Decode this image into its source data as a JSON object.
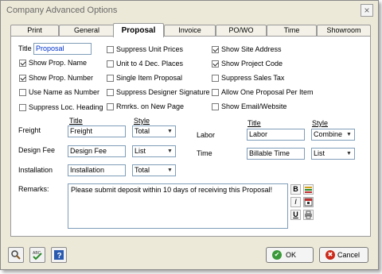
{
  "window": {
    "title": "Company Advanced Options",
    "close": "×"
  },
  "tabs": [
    "Print",
    "General",
    "Proposal",
    "Invoice",
    "PO/WO",
    "Time",
    "Showroom"
  ],
  "proposal": {
    "title_label": "Title",
    "title_value": "Proposal",
    "checkboxes": {
      "show_prop_name": {
        "label": "Show Prop. Name",
        "checked": true
      },
      "show_prop_number": {
        "label": "Show Prop. Number",
        "checked": true
      },
      "use_name_as_number": {
        "label": "Use Name as Number",
        "checked": false
      },
      "suppress_loc_heading": {
        "label": "Suppress Loc. Heading",
        "checked": false
      },
      "suppress_unit_prices": {
        "label": "Suppress Unit Prices",
        "checked": false
      },
      "unit_to_4_dec": {
        "label": "Unit to 4 Dec. Places",
        "checked": false
      },
      "single_item_proposal": {
        "label": "Single Item Proposal",
        "checked": false
      },
      "suppress_designer_signature": {
        "label": "Suppress Designer Signature",
        "checked": false
      },
      "rmrks_new_page": {
        "label": "Rmrks. on New Page",
        "checked": false
      },
      "show_site_address": {
        "label": "Show Site Address",
        "checked": true
      },
      "show_project_code": {
        "label": "Show Project Code",
        "checked": true
      },
      "suppress_sales_tax": {
        "label": "Suppress Sales Tax",
        "checked": false
      },
      "allow_one_proposal": {
        "label": "Allow One Proposal Per Item",
        "checked": false
      },
      "show_email_website": {
        "label": "Show Email/Website",
        "checked": false
      }
    },
    "col_title": "Title",
    "col_style": "Style",
    "rows": {
      "freight": {
        "label": "Freight",
        "title": "Freight",
        "style": "Total"
      },
      "design_fee": {
        "label": "Design Fee",
        "title": "Design Fee",
        "style": "List"
      },
      "installation": {
        "label": "Installation",
        "title": "Installation",
        "style": "Total"
      },
      "labor": {
        "label": "Labor",
        "title": "Labor",
        "style": "Combine"
      },
      "time": {
        "label": "Time",
        "title": "Billable Time",
        "style": "List"
      }
    },
    "remarks_label": "Remarks:",
    "remarks_text": "Please submit deposit within 10 days of receiving this Proposal!",
    "format_tools": {
      "bold": "B",
      "italic": "I",
      "underline": "U"
    }
  },
  "buttons": {
    "ok": "OK",
    "cancel": "Cancel"
  },
  "icons": [
    "magnifier-icon",
    "spellcheck-icon",
    "help-icon",
    "ok-check-icon",
    "cancel-x-icon",
    "color-lines-icon",
    "calendar-icon",
    "printer-icon"
  ]
}
